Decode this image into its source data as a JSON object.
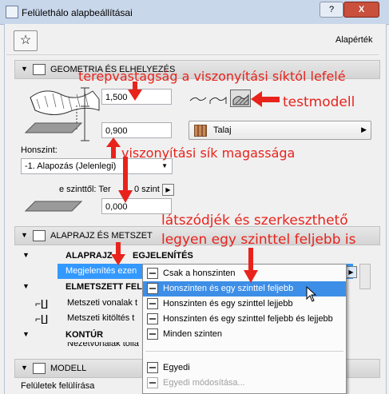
{
  "window": {
    "title": "Felülethálo alapbeállításai",
    "help": "?",
    "close": "X"
  },
  "toolbar": {
    "favorites_icon": "star-icon",
    "preset_label": "Alapérték"
  },
  "geometry_panel": {
    "title": "GEOMETRIA ÉS ELHELYEZÉS",
    "thickness_value": "1,500",
    "ref_height_value": "0,900",
    "home_story_label": "Honszint:",
    "home_story_value": "-1. Alapozás (Jelenlegi)",
    "offset_label": "e szinttől: Ter",
    "offset_label_2": "0 szint",
    "offset_value": "0,000"
  },
  "model_buttons": [
    "ridge-line-icon",
    "ridge-surface-icon",
    "solid-model-icon"
  ],
  "material": {
    "name": "Talaj"
  },
  "floorplan_panel": {
    "title": "ALAPRAJZ ÉS METSZET"
  },
  "tree": {
    "group_floorplan": "ALAPRAJZ",
    "group_floorplan_suffix": "EGJELENÍTÉS",
    "show_on_label": "Megjelenítés ezen",
    "group_cut": "ELMETSZETT FELÜ",
    "cut_lines": "Metszeti vonalak t",
    "cut_fill": "Metszeti kitöltés t",
    "group_outline": "KONTÚR",
    "outline_partial": "Nézetvonalak tolla"
  },
  "dropdown_menu": {
    "items": [
      "Csak a honszinten",
      "Honszinten és egy szinttel feljebb",
      "Honszinten és egy szinttel lejjebb",
      "Honszinten és egy szinttel feljebb és lejjebb",
      "Minden szinten"
    ],
    "custom": "Egyedi",
    "custom_edit": "Egyedi módosítása..."
  },
  "model_panel": {
    "title": "MODELL",
    "surface_override": "Felületek felülírása"
  },
  "annotations": {
    "thickness": "terepvastagság a viszonyítási síktól lefelé",
    "solid_model": "testmodell",
    "ref_height": "viszonyítási sík magassága",
    "visibility_1": "látszódjék és szerkeszthető",
    "visibility_2": "legyen egy szinttel feljebb is"
  },
  "colors": {
    "annotation": "#e8231c",
    "highlight": "#3399ff",
    "titlebar": "#c9d7ea"
  }
}
